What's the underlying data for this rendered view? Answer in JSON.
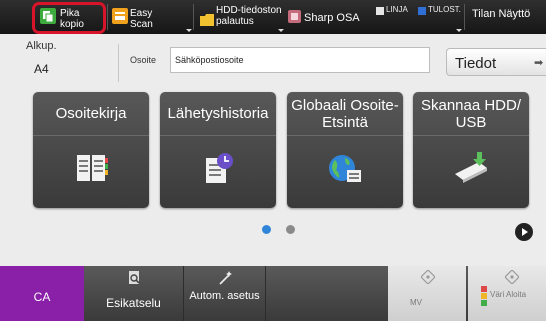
{
  "topbar": {
    "items": [
      {
        "label": "Pika kopio",
        "icon": "copy-icon"
      },
      {
        "label": "Easy Scan",
        "icon": "scan-icon"
      },
      {
        "label": "HDD-tiedoston palautus",
        "icon": "folder-icon"
      },
      {
        "label": "Sharp OSA",
        "icon": "osa-icon"
      }
    ],
    "status": {
      "linja": "LINJA",
      "tulost": "TULOST."
    },
    "mode_button": "Tilan Näyttö",
    "colors": {
      "linja": "#e6e6e6",
      "tulost": "#2f6fd6",
      "highlight": "#d8142a"
    }
  },
  "address": {
    "original_label": "Alkup.",
    "original_value": "A4",
    "osoite_label": "Osoite",
    "osoite_value": "Sähköpostiosoite",
    "details_button": "Tiedot"
  },
  "tiles": [
    {
      "label": "Osoitekirja",
      "icon": "address-book-icon"
    },
    {
      "label": "Lähetyshistoria",
      "icon": "history-icon"
    },
    {
      "label": "Globaali Osoite-Etsintä",
      "icon": "globe-icon"
    },
    {
      "label": "Skannaa HDD/ USB",
      "icon": "usb-download-icon"
    }
  ],
  "pager": {
    "pages": 2,
    "current": 1
  },
  "bottom": {
    "ca": "CA",
    "preview": "Esikatselu",
    "auto_set": "Autom. asetus",
    "mono_start": "MV",
    "color_start": "Väri Aloita",
    "ca_color": "#8a1fa8"
  }
}
